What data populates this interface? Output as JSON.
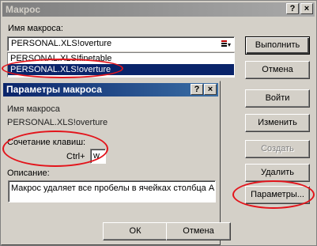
{
  "outer_dialog": {
    "title": "Макрос",
    "help_button": "?",
    "close_button": "×",
    "macro_name_label": "Имя макроса:",
    "macro_name_value": "PERSONAL.XLS!overture",
    "macro_list": [
      "PERSONAL.XLS!finetable",
      "PERSONAL.XLS!overture"
    ],
    "selected_index": 1,
    "buttons": {
      "run": "Выполнить",
      "cancel": "Отмена",
      "step_into": "Войти",
      "edit": "Изменить",
      "create": "Создать",
      "delete": "Удалить",
      "options": "Параметры..."
    }
  },
  "options_dialog": {
    "title": "Параметры макроса",
    "help_button": "?",
    "close_button": "×",
    "macro_name_label": "Имя макроса",
    "macro_name_value": "PERSONAL.XLS!overture",
    "shortcut_label": "Сочетание клавиш:",
    "shortcut_prefix": "Ctrl+",
    "shortcut_key": "w",
    "description_label": "Описание:",
    "description_value": "Макрос удаляет все пробелы в ячейках столбца А.",
    "ok_button": "ОК",
    "cancel_button": "Отмена"
  },
  "annotation_color": "#e3141b"
}
